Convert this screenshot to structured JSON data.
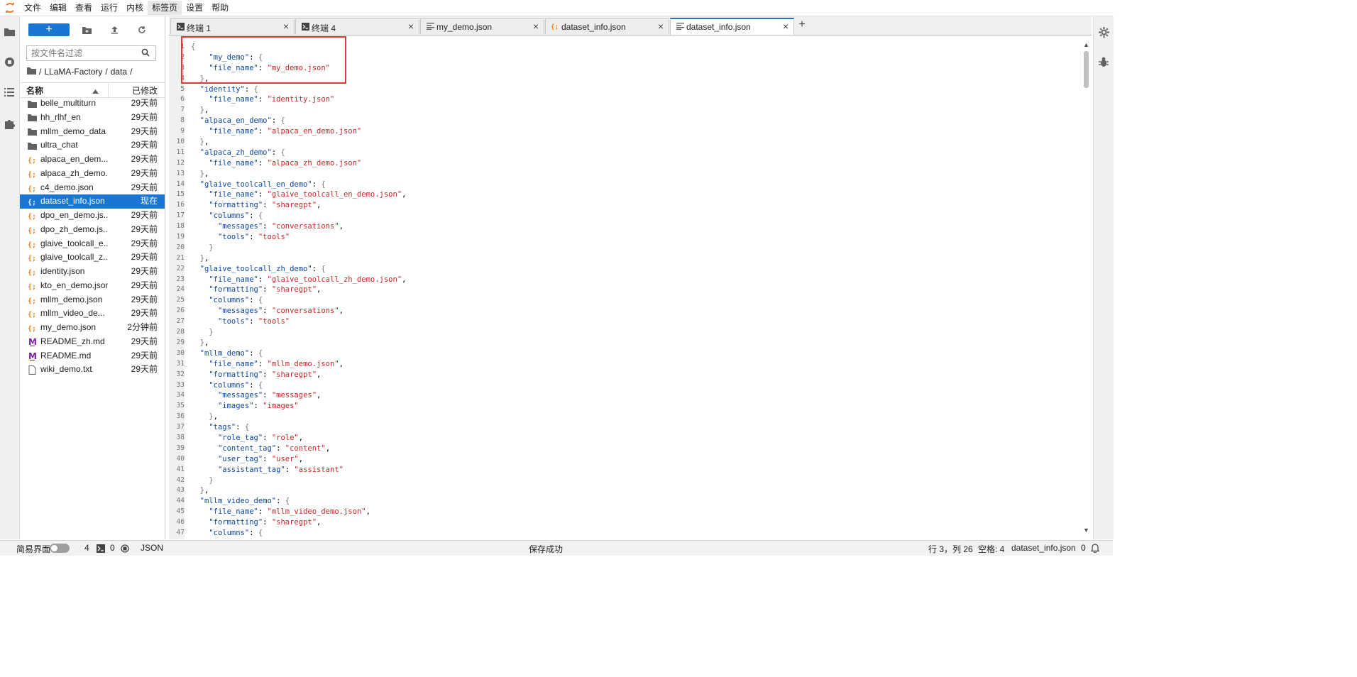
{
  "menubar": {
    "items": [
      "文件",
      "编辑",
      "查看",
      "运行",
      "内核",
      "标签页",
      "设置",
      "帮助"
    ],
    "active": "标签页"
  },
  "colors": {
    "accent": "#1976d2",
    "highlight_box": "#e53935",
    "json_key": "#0d47a1",
    "json_string": "#c62828"
  },
  "left_sidebar": {
    "icons": [
      "folder-icon",
      "running-icon",
      "toc-icon",
      "extension-icon"
    ]
  },
  "filebrowser": {
    "new_label": "+",
    "filter_placeholder": "按文件名过滤",
    "breadcrumb": [
      "LLaMA-Factory",
      "data"
    ],
    "header": {
      "name": "名称",
      "modified": "已修改"
    },
    "files": [
      {
        "name": "belle_multiturn",
        "modified": "29天前",
        "type": "folder"
      },
      {
        "name": "hh_rlhf_en",
        "modified": "29天前",
        "type": "folder"
      },
      {
        "name": "mllm_demo_data",
        "modified": "29天前",
        "type": "folder"
      },
      {
        "name": "ultra_chat",
        "modified": "29天前",
        "type": "folder"
      },
      {
        "name": "alpaca_en_dem...",
        "modified": "29天前",
        "type": "json"
      },
      {
        "name": "alpaca_zh_demo...",
        "modified": "29天前",
        "type": "json"
      },
      {
        "name": "c4_demo.json",
        "modified": "29天前",
        "type": "json"
      },
      {
        "name": "dataset_info.json",
        "modified": "现在",
        "type": "json",
        "selected": true
      },
      {
        "name": "dpo_en_demo.js...",
        "modified": "29天前",
        "type": "json"
      },
      {
        "name": "dpo_zh_demo.js...",
        "modified": "29天前",
        "type": "json"
      },
      {
        "name": "glaive_toolcall_e...",
        "modified": "29天前",
        "type": "json"
      },
      {
        "name": "glaive_toolcall_z...",
        "modified": "29天前",
        "type": "json"
      },
      {
        "name": "identity.json",
        "modified": "29天前",
        "type": "json"
      },
      {
        "name": "kto_en_demo.json",
        "modified": "29天前",
        "type": "json"
      },
      {
        "name": "mllm_demo.json",
        "modified": "29天前",
        "type": "json"
      },
      {
        "name": "mllm_video_de...",
        "modified": "29天前",
        "type": "json"
      },
      {
        "name": "my_demo.json",
        "modified": "2分钟前",
        "type": "json"
      },
      {
        "name": "README_zh.md",
        "modified": "29天前",
        "type": "md"
      },
      {
        "name": "README.md",
        "modified": "29天前",
        "type": "md"
      },
      {
        "name": "wiki_demo.txt",
        "modified": "29天前",
        "type": "txt"
      }
    ]
  },
  "tabs": [
    {
      "label": "终端 1",
      "icon": "terminal-icon",
      "active": false
    },
    {
      "label": "终端 4",
      "icon": "terminal-icon",
      "active": false
    },
    {
      "label": "my_demo.json",
      "icon": "text-file-icon",
      "active": false
    },
    {
      "label": "dataset_info.json",
      "icon": "json-icon",
      "active": false
    },
    {
      "label": "dataset_info.json",
      "icon": "text-file-icon",
      "active": true
    }
  ],
  "add_tab_label": "+",
  "editor": {
    "lines": [
      "{",
      "    \"my_demo\": {",
      "    \"file_name\": \"my_demo.json\"",
      "  },",
      "  \"identity\": {",
      "    \"file_name\": \"identity.json\"",
      "  },",
      "  \"alpaca_en_demo\": {",
      "    \"file_name\": \"alpaca_en_demo.json\"",
      "  },",
      "  \"alpaca_zh_demo\": {",
      "    \"file_name\": \"alpaca_zh_demo.json\"",
      "  },",
      "  \"glaive_toolcall_en_demo\": {",
      "    \"file_name\": \"glaive_toolcall_en_demo.json\",",
      "    \"formatting\": \"sharegpt\",",
      "    \"columns\": {",
      "      \"messages\": \"conversations\",",
      "      \"tools\": \"tools\"",
      "    }",
      "  },",
      "  \"glaive_toolcall_zh_demo\": {",
      "    \"file_name\": \"glaive_toolcall_zh_demo.json\",",
      "    \"formatting\": \"sharegpt\",",
      "    \"columns\": {",
      "      \"messages\": \"conversations\",",
      "      \"tools\": \"tools\"",
      "    }",
      "  },",
      "  \"mllm_demo\": {",
      "    \"file_name\": \"mllm_demo.json\",",
      "    \"formatting\": \"sharegpt\",",
      "    \"columns\": {",
      "      \"messages\": \"messages\",",
      "      \"images\": \"images\"",
      "    },",
      "    \"tags\": {",
      "      \"role_tag\": \"role\",",
      "      \"content_tag\": \"content\",",
      "      \"user_tag\": \"user\",",
      "      \"assistant_tag\": \"assistant\"",
      "    }",
      "  },",
      "  \"mllm_video_demo\": {",
      "    \"file_name\": \"mllm_video_demo.json\",",
      "    \"formatting\": \"sharegpt\",",
      "    \"columns\": {"
    ]
  },
  "right_sidebar": {
    "icons": [
      "property-inspector-icon",
      "debugger-icon"
    ]
  },
  "statusbar": {
    "simple_mode": "简易界面",
    "terminals": "4",
    "kernels": "0",
    "file_type": "JSON",
    "save_status": "保存成功",
    "cursor": "行 3，列 26",
    "spaces": "空格: 4",
    "filename": "dataset_info.json",
    "notifications": "0"
  }
}
